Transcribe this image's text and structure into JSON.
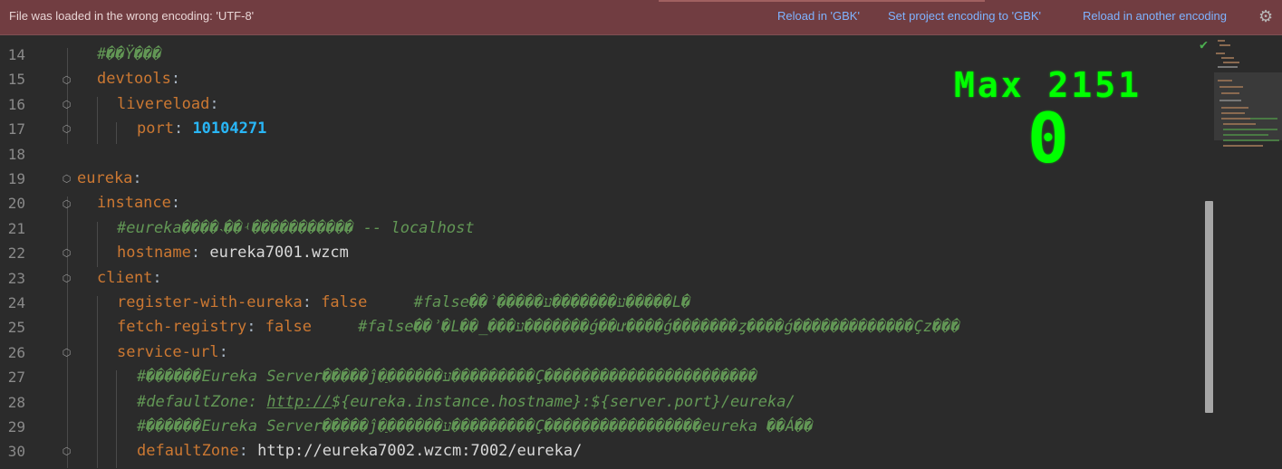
{
  "banner": {
    "message": "File was loaded in the wrong encoding: 'UTF-8'",
    "actions": [
      "Reload in 'GBK'",
      "Set project encoding to 'GBK'",
      "Reload in another encoding"
    ]
  },
  "overlay": {
    "max_label": "Max 2151",
    "score": "0"
  },
  "lines": [
    {
      "num": "14",
      "key": "",
      "comment": "#��Ÿ���"
    },
    {
      "num": "15",
      "key": "devtools"
    },
    {
      "num": "16",
      "key": "livereload"
    },
    {
      "num": "17",
      "key": "port",
      "value": "10104271"
    },
    {
      "num": "18"
    },
    {
      "num": "19",
      "key": "eureka"
    },
    {
      "num": "20",
      "key": "instance"
    },
    {
      "num": "21",
      "comment": "#eureka����˴��ʵ����������� -- localhost"
    },
    {
      "num": "22",
      "key": "hostname",
      "value": "eureka7001.wzcm"
    },
    {
      "num": "23",
      "key": "client"
    },
    {
      "num": "24",
      "key": "register-with-eureka",
      "value": "false",
      "comment": "#false��ʾ�����ע�������ע�����L�"
    },
    {
      "num": "25",
      "key": "fetch-registry",
      "value": "false",
      "comment": "#false��ʾ�L��_���ע�������ǵ��ư����ǵ�������ȥ����ǵ�������������Çz���"
    },
    {
      "num": "26",
      "key": "service-url"
    },
    {
      "num": "27",
      "comment": "#������Eureka Server�����ĵ�ַ������ע���������Ç�����������������������"
    },
    {
      "num": "28",
      "comment_pre": "#defaultZone: ",
      "comment_link": "http://",
      "comment_post": "${eureka.instance.hostname}:${server.port}/eureka/"
    },
    {
      "num": "29",
      "comment": "#������Eureka Server�����ĵ�ַ������ע���������Ç�����������������eureka ��Á��"
    },
    {
      "num": "30",
      "key": "defaultZone",
      "value": "http://eureka7002.wzcm:7002/eureka/"
    }
  ]
}
